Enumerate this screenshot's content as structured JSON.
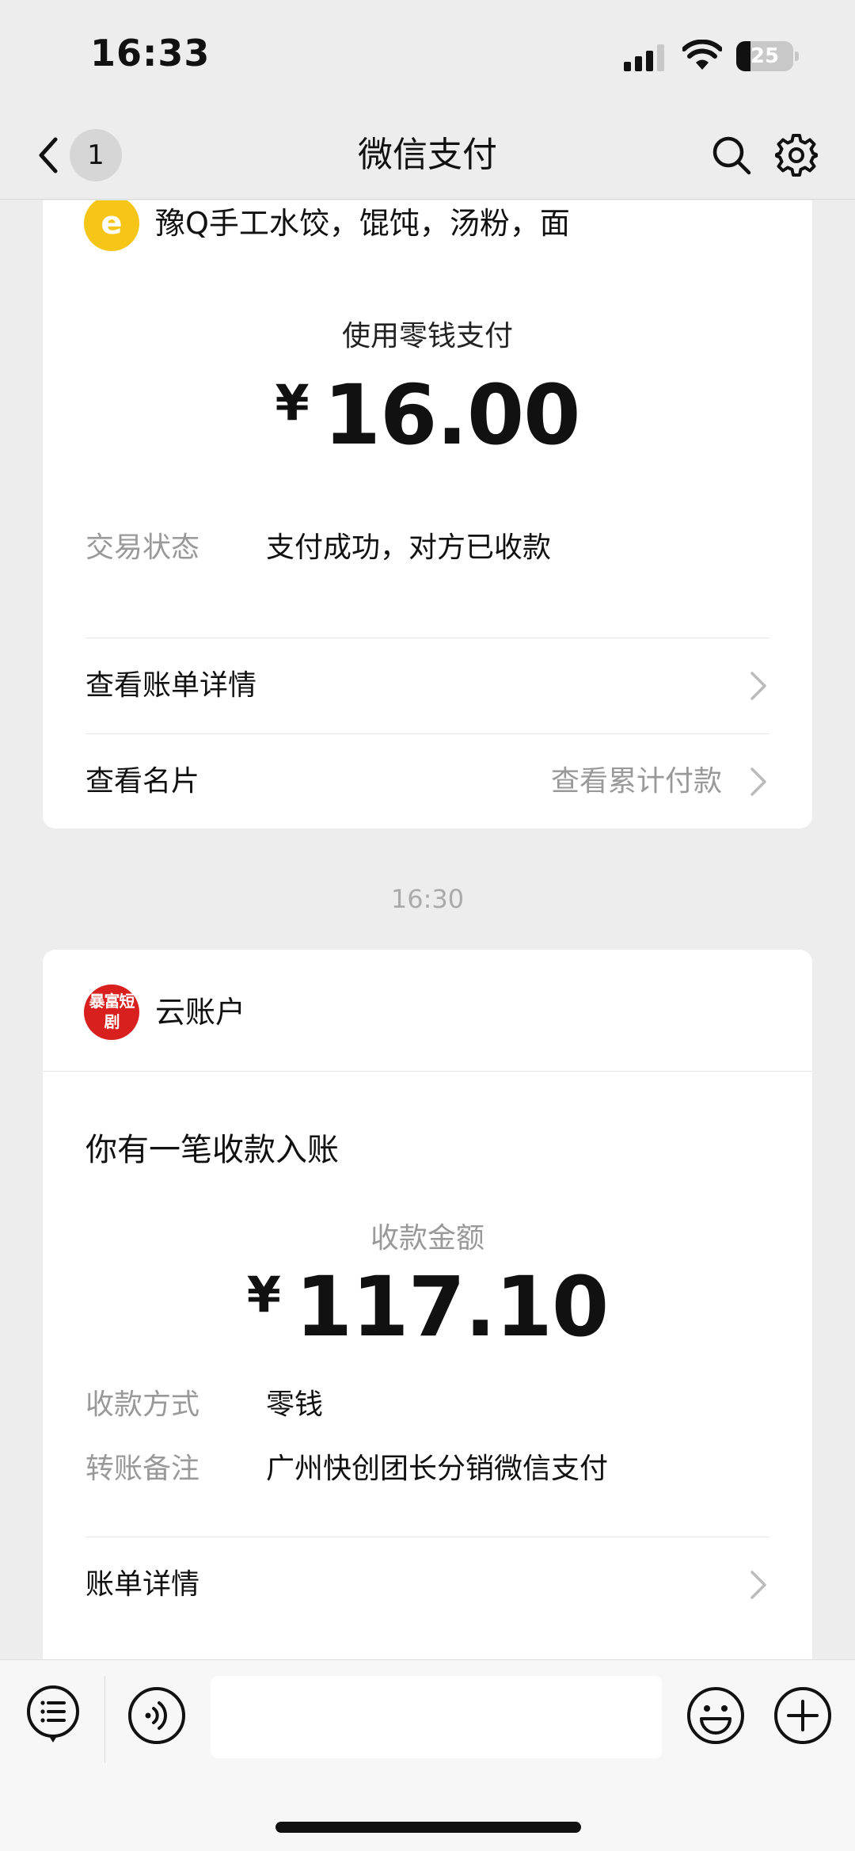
{
  "status_bar": {
    "time": "16:33",
    "battery_level": "25",
    "icons": [
      "signal-icon",
      "wifi-icon",
      "battery-icon"
    ]
  },
  "nav": {
    "back_icon": "chevron-left-icon",
    "unread_count": "1",
    "title": "微信支付",
    "search_icon": "search-icon",
    "settings_icon": "gear-icon"
  },
  "payment_card": {
    "merchant_logo_glyph": "e",
    "merchant_name": "豫Q手工水饺，馄饨，汤粉，面",
    "pay_method": "使用零钱支付",
    "currency": "¥",
    "amount": "16.00",
    "status_label": "交易状态",
    "status_value": "支付成功，对方已收款",
    "bill_detail_label": "查看账单详情",
    "card_label": "查看名片",
    "cumulative_label": "查看累计付款"
  },
  "timestamp": "16:30",
  "receipt_card": {
    "account_logo_text": "暴富短剧",
    "account_name": "云账户",
    "title": "你有一笔收款入账",
    "amount_label": "收款金额",
    "currency": "¥",
    "amount": "117.10",
    "method_label": "收款方式",
    "method_value": "零钱",
    "note_label": "转账备注",
    "note_value": "广州快创团长分销微信支付",
    "bill_detail_label": "账单详情"
  },
  "input_bar": {
    "menu_icon": "list-menu-icon",
    "voice_icon": "voice-icon",
    "text_value": "",
    "emoji_icon": "emoji-icon",
    "plus_icon": "plus-icon"
  },
  "colors": {
    "background": "#ededed",
    "card": "#ffffff",
    "merchant_logo": "#f5c518",
    "account_logo": "#d8201e",
    "secondary_text": "#999999"
  }
}
